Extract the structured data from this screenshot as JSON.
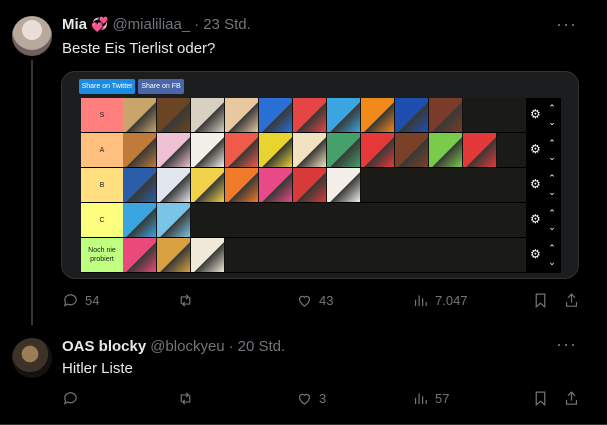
{
  "tweets": [
    {
      "name": "Mia",
      "name_emoji": "💞",
      "handle": "@mialiliaa_",
      "time": "23 Std.",
      "text": "Beste Eis Tierlist oder?",
      "stats": {
        "replies": "54",
        "retweets": "",
        "likes": "43",
        "views": "7.047"
      }
    },
    {
      "name": "OAS blocky",
      "handle": "@blockyeu",
      "time": "20 Std.",
      "text": "Hitler Liste",
      "stats": {
        "replies": "",
        "retweets": "",
        "likes": "3",
        "views": "57"
      }
    }
  ],
  "tierlist": {
    "share_twitter": "Share on Twitter",
    "share_fb": "Share on FB",
    "rows": [
      {
        "label": "S",
        "color": "#ff7f7f",
        "items": [
          "#c9a56b",
          "#6b4423",
          "#d8d0c0",
          "#e8c8a0",
          "#2a6fd6",
          "#e54545",
          "#3aa5e0",
          "#f08a1a",
          "#1e4fb0",
          "#7a3b2a"
        ]
      },
      {
        "label": "A",
        "color": "#ffbf7f",
        "items": [
          "#c07a3a",
          "#efc1d3",
          "#f3f0ea",
          "#f05a4a",
          "#e8d430",
          "#f3e2c0",
          "#45a06a",
          "#e63a3a",
          "#7a4028",
          "#7acb4a",
          "#e23a3a"
        ]
      },
      {
        "label": "B",
        "color": "#ffdf7f",
        "items": [
          "#2a5ea8",
          "#e2e6ef",
          "#f1d24a",
          "#f07a2a",
          "#e84a88",
          "#d83a3a",
          "#f3eee8"
        ]
      },
      {
        "label": "C",
        "color": "#ffff7f",
        "items": [
          "#3aa5e0",
          "#7ac4e8"
        ]
      },
      {
        "label": "Noch nie probiert",
        "color": "#bfff7f",
        "items": [
          "#e94a7a",
          "#d8a040",
          "#f0e8d8"
        ]
      }
    ]
  }
}
